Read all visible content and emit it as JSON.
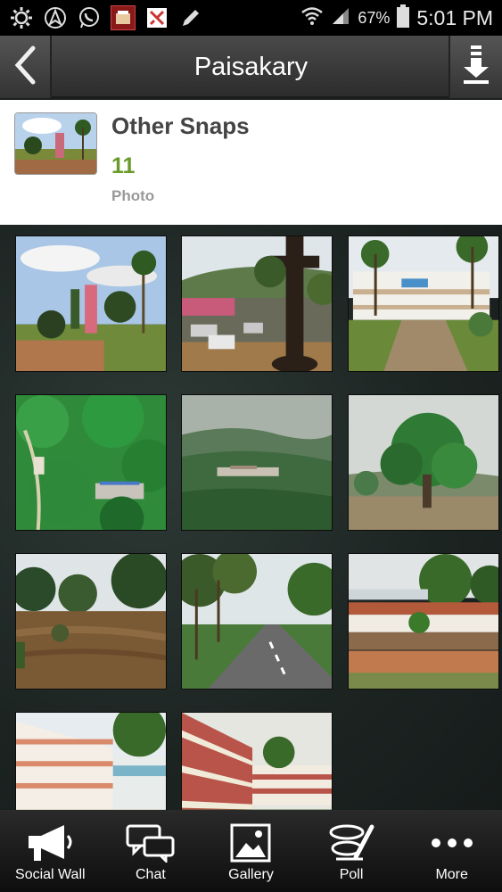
{
  "status_bar": {
    "battery_percent": "67%",
    "time": "5:01 PM",
    "icons": [
      "settings-gear-icon",
      "navigation-arrow-icon",
      "whatsapp-icon",
      "app-notification-icon",
      "muted-app-icon",
      "pencil-icon",
      "wifi-icon",
      "signal-icon",
      "battery-icon"
    ]
  },
  "header": {
    "title": "Paisakary",
    "back_icon": "chevron-left-icon",
    "download_icon": "download-icon"
  },
  "album": {
    "title": "Other Snaps",
    "count": "11",
    "count_label": "Photo"
  },
  "gallery": {
    "photos": [
      {
        "subject": "church courtyard"
      },
      {
        "subject": "stone cross and parked cars"
      },
      {
        "subject": "school building"
      },
      {
        "subject": "aerial forest valley"
      },
      {
        "subject": "misty hills"
      },
      {
        "subject": "tree in flood"
      },
      {
        "subject": "flooded river"
      },
      {
        "subject": "road through palms"
      },
      {
        "subject": "red roof school"
      },
      {
        "subject": "school building front"
      },
      {
        "subject": "school balconies"
      }
    ]
  },
  "bottom_nav": {
    "items": [
      {
        "label": "Social Wall",
        "icon": "megaphone-icon"
      },
      {
        "label": "Chat",
        "icon": "chat-bubbles-icon"
      },
      {
        "label": "Gallery",
        "icon": "image-icon"
      },
      {
        "label": "Poll",
        "icon": "poll-icon"
      },
      {
        "label": "More",
        "icon": "more-dots-icon"
      }
    ]
  },
  "colors": {
    "accent_green": "#6a9a2a",
    "title_bar": "#3a3a3a",
    "nav_bg": "#1a1a1a"
  }
}
